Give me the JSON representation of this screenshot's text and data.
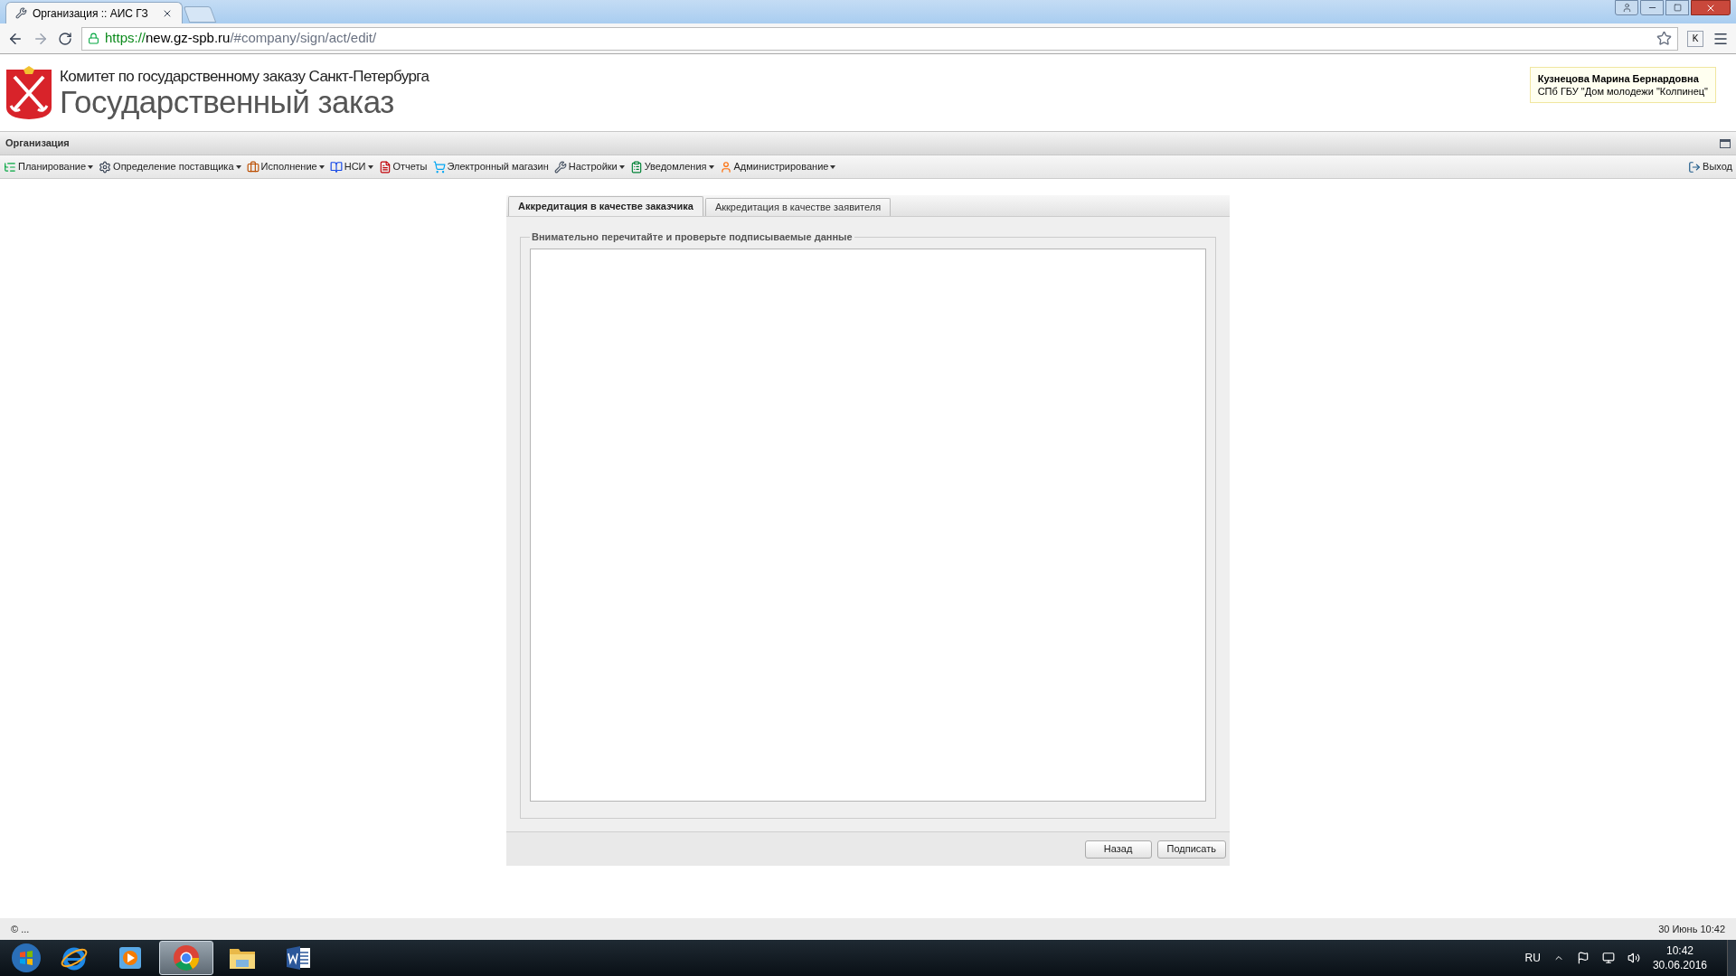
{
  "browser": {
    "tab_title": "Организация :: АИС ГЗ",
    "url": {
      "scheme": "https://",
      "host": "new.gz-spb.ru",
      "path": "/#company/sign/act/edit/"
    },
    "extension_label": "K"
  },
  "header": {
    "subtitle": "Комитет по государственному заказу Санкт-Петербурга",
    "title": "Государственный заказ",
    "user": {
      "name": "Кузнецова Марина Бернардовна",
      "organization": "СПб ГБУ \"Дом молодежи \"Колпинец\""
    }
  },
  "section_title": "Организация",
  "menu": {
    "items": [
      {
        "label": "Планирование",
        "dropdown": true
      },
      {
        "label": "Определение поставщика",
        "dropdown": true
      },
      {
        "label": "Исполнение",
        "dropdown": true
      },
      {
        "label": "НСИ",
        "dropdown": true
      },
      {
        "label": "Отчеты",
        "dropdown": false
      },
      {
        "label": "Электронный магазин",
        "dropdown": false
      },
      {
        "label": "Настройки",
        "dropdown": true
      },
      {
        "label": "Уведомления",
        "dropdown": true
      },
      {
        "label": "Администрирование",
        "dropdown": true
      }
    ],
    "logout": "Выход"
  },
  "tabs": [
    {
      "label": "Аккредитация в качестве заказчика",
      "selected": true
    },
    {
      "label": "Аккредитация в качестве заявителя",
      "selected": false
    }
  ],
  "fieldset": {
    "legend": "Внимательно перечитайте и проверьте подписываемые данные"
  },
  "buttons": [
    "Назад",
    "Подписать"
  ],
  "status_bar": {
    "left": "© ...",
    "right": "30 Июнь 10:42"
  },
  "taskbar": {
    "apps": [
      {
        "active": false
      },
      {
        "active": false
      },
      {
        "active": true
      },
      {
        "active": false
      },
      {
        "active": false
      }
    ],
    "language": "RU",
    "time": "10:42",
    "date": "30.06.2016"
  }
}
